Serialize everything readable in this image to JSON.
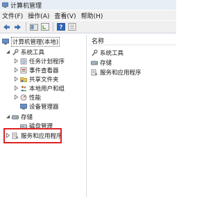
{
  "window": {
    "title": "计算机管理"
  },
  "menu": [
    "文件(F)",
    "操作(A)",
    "查看(V)",
    "帮助(H)"
  ],
  "toolbar": {
    "buttons": [
      "back",
      "forward",
      "up",
      "show-hide-tree",
      "help",
      "properties"
    ]
  },
  "tree": {
    "root": "计算机管理(本地)",
    "items": [
      {
        "label": "系统工具",
        "level": 1,
        "expander": "expanded",
        "icon": "tools-icon"
      },
      {
        "label": "任务计划程序",
        "level": 2,
        "expander": "collapsed",
        "icon": "task-scheduler-icon"
      },
      {
        "label": "事件查看器",
        "level": 2,
        "expander": "collapsed",
        "icon": "event-viewer-icon"
      },
      {
        "label": "共享文件夹",
        "level": 2,
        "expander": "collapsed",
        "icon": "shared-folder-icon"
      },
      {
        "label": "本地用户和组",
        "level": 2,
        "expander": "collapsed",
        "icon": "users-icon"
      },
      {
        "label": "性能",
        "level": 2,
        "expander": "collapsed",
        "icon": "performance-icon"
      },
      {
        "label": "设备管理器",
        "level": 2,
        "expander": "none",
        "icon": "device-manager-icon"
      },
      {
        "label": "存储",
        "level": 1,
        "expander": "expanded",
        "icon": "storage-icon"
      },
      {
        "label": "磁盘管理",
        "level": 2,
        "expander": "none",
        "icon": "disk-icon"
      },
      {
        "label": "服务和应用程序",
        "level": 1,
        "expander": "collapsed",
        "icon": "services-icon"
      }
    ]
  },
  "list": {
    "header": "名称",
    "items": [
      {
        "label": "系统工具",
        "icon": "tools-icon"
      },
      {
        "label": "存储",
        "icon": "storage-icon"
      },
      {
        "label": "服务和应用程序",
        "icon": "services-icon"
      }
    ]
  },
  "colors": {
    "highlight": "#e02020",
    "titlebar": "#e8eef6",
    "chrome": "#f0f0f0"
  }
}
